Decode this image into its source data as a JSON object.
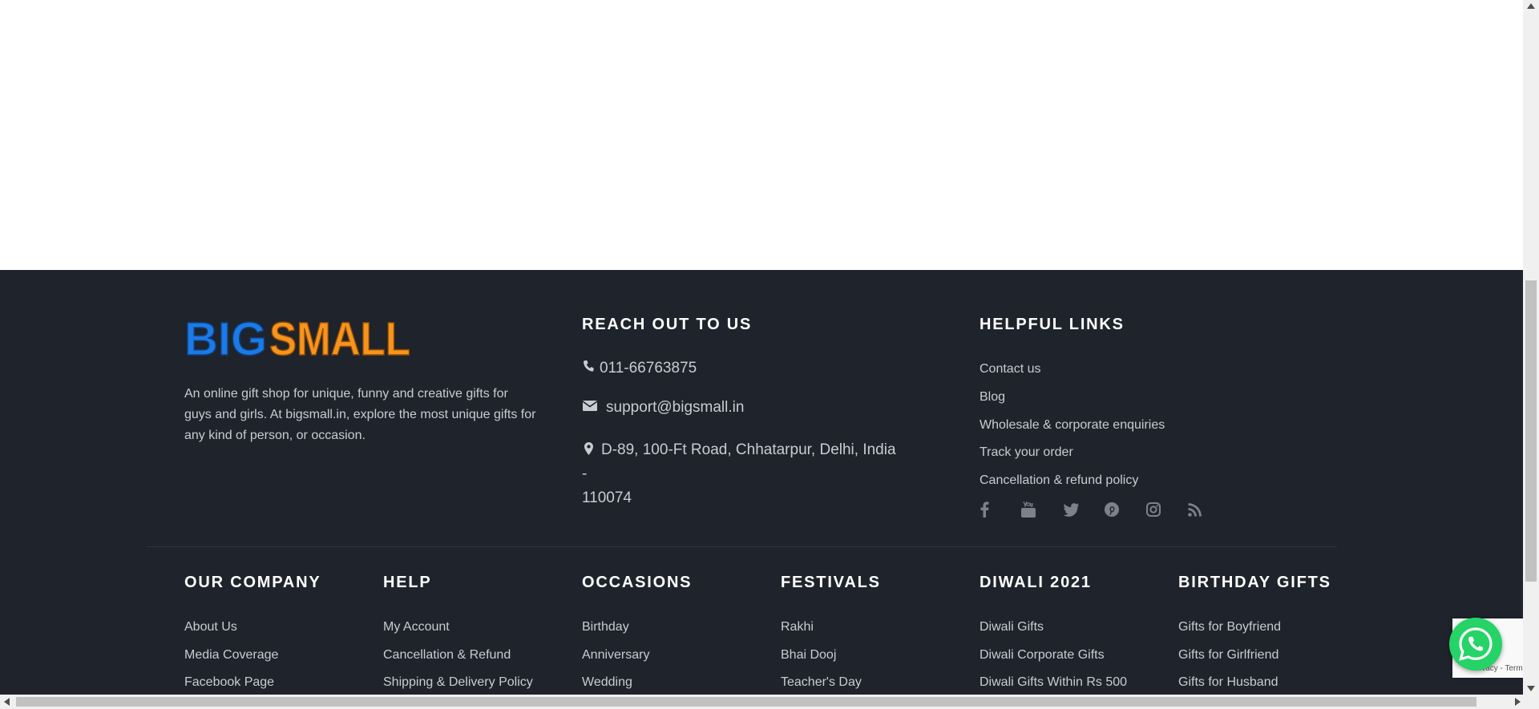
{
  "colors": {
    "footer_bg": "#1f232b",
    "text": "#c9ccd1",
    "heading": "#ffffff",
    "logo_blue": "#1c7ae6",
    "logo_orange": "#f7941d",
    "whatsapp": "#25d366"
  },
  "brand": {
    "logo_text": "BIGSMALL",
    "logo_part1": "BIG",
    "logo_part2": "SMALL"
  },
  "about": {
    "text": "An online gift shop for unique, funny and creative gifts for guys and girls. At bigsmall.in, explore the most unique gifts for any kind of person, or occasion."
  },
  "reach": {
    "heading": "REACH OUT TO US",
    "phone": "011-66763875",
    "email": "support@bigsmall.in",
    "address_line1": "D-89, 100-Ft Road, Chhatarpur, Delhi, India -",
    "address_line2": "110074"
  },
  "helpful": {
    "heading": "HELPFUL LINKS",
    "links": [
      "Contact us",
      "Blog",
      "Wholesale & corporate enquiries",
      "Track your order",
      "Cancellation & refund policy"
    ]
  },
  "social": [
    "facebook-icon",
    "youtube-icon",
    "twitter-icon",
    "pinterest-icon",
    "instagram-icon",
    "rss-icon"
  ],
  "columns": [
    {
      "heading": "OUR COMPANY",
      "links": [
        "About Us",
        "Media Coverage",
        "Facebook Page"
      ]
    },
    {
      "heading": "HELP",
      "links": [
        "My Account",
        "Cancellation & Refund",
        "Shipping & Delivery Policy"
      ]
    },
    {
      "heading": "OCCASIONS",
      "links": [
        "Birthday",
        "Anniversary",
        "Wedding"
      ]
    },
    {
      "heading": "FESTIVALS",
      "links": [
        "Rakhi",
        "Bhai Dooj",
        "Teacher's Day"
      ]
    },
    {
      "heading": "DIWALI 2021",
      "links": [
        "Diwali Gifts",
        "Diwali Corporate Gifts",
        "Diwali Gifts Within Rs 500"
      ]
    },
    {
      "heading": "BIRTHDAY GIFTS",
      "links": [
        "Gifts for Boyfriend",
        "Gifts for Girlfriend",
        "Gifts for Husband"
      ]
    }
  ],
  "recaptcha": {
    "text": "Privacy - Terms"
  }
}
